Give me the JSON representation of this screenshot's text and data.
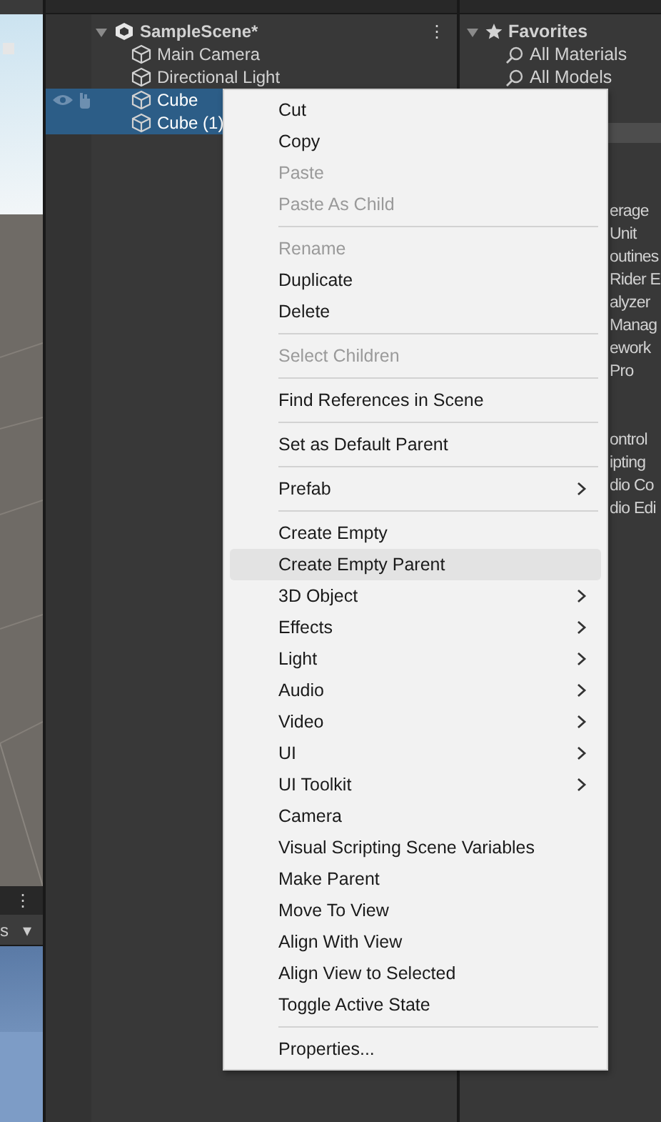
{
  "scene_view": {
    "kind": "picture",
    "toolbar_menu": "⋮",
    "toolbar_label": "s",
    "toolbar_dropdown": "▾"
  },
  "hierarchy": {
    "scene": {
      "name": "SampleScene*",
      "expanded": true,
      "menu": "⋮"
    },
    "items": [
      {
        "name": "Main Camera",
        "selected": false
      },
      {
        "name": "Directional Light",
        "selected": false
      },
      {
        "name": "Cube",
        "selected": true
      },
      {
        "name": "Cube (1)",
        "selected": true
      }
    ]
  },
  "project": {
    "favorites": {
      "label": "Favorites",
      "expanded": true
    },
    "searches": [
      "All Materials",
      "All Models"
    ],
    "group_1": [
      "erage",
      "Unit",
      "outines",
      "Rider E",
      "alyzer",
      "Manag",
      "ework",
      "Pro"
    ],
    "group_2": [
      "ontrol",
      "ipting",
      "dio Co",
      "dio Edi"
    ]
  },
  "context_menu": {
    "items": [
      {
        "kind": "item",
        "label": "Cut",
        "disabled": false,
        "submenu": false,
        "highlighted": false
      },
      {
        "kind": "item",
        "label": "Copy",
        "disabled": false,
        "submenu": false,
        "highlighted": false
      },
      {
        "kind": "item",
        "label": "Paste",
        "disabled": true,
        "submenu": false,
        "highlighted": false
      },
      {
        "kind": "item",
        "label": "Paste As Child",
        "disabled": true,
        "submenu": false,
        "highlighted": false
      },
      {
        "kind": "separator"
      },
      {
        "kind": "item",
        "label": "Rename",
        "disabled": true,
        "submenu": false,
        "highlighted": false
      },
      {
        "kind": "item",
        "label": "Duplicate",
        "disabled": false,
        "submenu": false,
        "highlighted": false
      },
      {
        "kind": "item",
        "label": "Delete",
        "disabled": false,
        "submenu": false,
        "highlighted": false
      },
      {
        "kind": "separator"
      },
      {
        "kind": "item",
        "label": "Select Children",
        "disabled": true,
        "submenu": false,
        "highlighted": false
      },
      {
        "kind": "separator"
      },
      {
        "kind": "item",
        "label": "Find References in Scene",
        "disabled": false,
        "submenu": false,
        "highlighted": false
      },
      {
        "kind": "separator"
      },
      {
        "kind": "item",
        "label": "Set as Default Parent",
        "disabled": false,
        "submenu": false,
        "highlighted": false
      },
      {
        "kind": "separator"
      },
      {
        "kind": "item",
        "label": "Prefab",
        "disabled": false,
        "submenu": true,
        "highlighted": false
      },
      {
        "kind": "separator"
      },
      {
        "kind": "item",
        "label": "Create Empty",
        "disabled": false,
        "submenu": false,
        "highlighted": false
      },
      {
        "kind": "item",
        "label": "Create Empty Parent",
        "disabled": false,
        "submenu": false,
        "highlighted": true
      },
      {
        "kind": "item",
        "label": "3D Object",
        "disabled": false,
        "submenu": true,
        "highlighted": false
      },
      {
        "kind": "item",
        "label": "Effects",
        "disabled": false,
        "submenu": true,
        "highlighted": false
      },
      {
        "kind": "item",
        "label": "Light",
        "disabled": false,
        "submenu": true,
        "highlighted": false
      },
      {
        "kind": "item",
        "label": "Audio",
        "disabled": false,
        "submenu": true,
        "highlighted": false
      },
      {
        "kind": "item",
        "label": "Video",
        "disabled": false,
        "submenu": true,
        "highlighted": false
      },
      {
        "kind": "item",
        "label": "UI",
        "disabled": false,
        "submenu": true,
        "highlighted": false
      },
      {
        "kind": "item",
        "label": "UI Toolkit",
        "disabled": false,
        "submenu": true,
        "highlighted": false
      },
      {
        "kind": "item",
        "label": "Camera",
        "disabled": false,
        "submenu": false,
        "highlighted": false
      },
      {
        "kind": "item",
        "label": "Visual Scripting Scene Variables",
        "disabled": false,
        "submenu": false,
        "highlighted": false
      },
      {
        "kind": "item",
        "label": "Make Parent",
        "disabled": false,
        "submenu": false,
        "highlighted": false
      },
      {
        "kind": "item",
        "label": "Move To View",
        "disabled": false,
        "submenu": false,
        "highlighted": false
      },
      {
        "kind": "item",
        "label": "Align With View",
        "disabled": false,
        "submenu": false,
        "highlighted": false
      },
      {
        "kind": "item",
        "label": "Align View to Selected",
        "disabled": false,
        "submenu": false,
        "highlighted": false
      },
      {
        "kind": "item",
        "label": "Toggle Active State",
        "disabled": false,
        "submenu": false,
        "highlighted": false
      },
      {
        "kind": "separator"
      },
      {
        "kind": "item",
        "label": "Properties...",
        "disabled": false,
        "submenu": false,
        "highlighted": false
      }
    ]
  }
}
